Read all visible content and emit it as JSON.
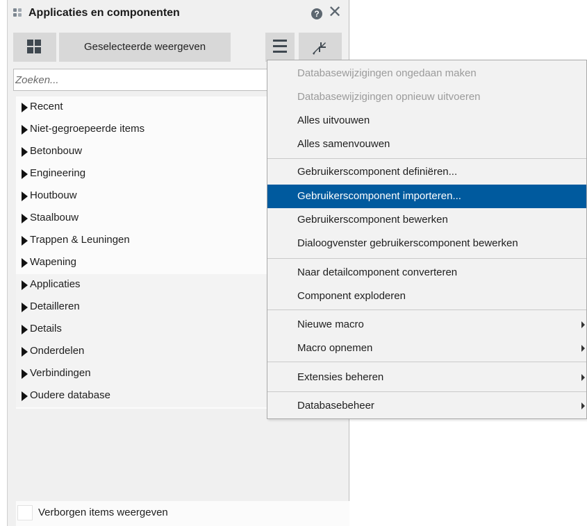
{
  "panel": {
    "title": "Applicaties en componenten",
    "help_icon": "?",
    "close_icon": "✕",
    "selected_button": "Geselecteerde weergeven",
    "search_placeholder": "Zoeken...",
    "footer_label": "Verborgen items weergeven"
  },
  "tree": [
    "Recent",
    "Niet-gegroepeerde items",
    "Betonbouw",
    "Engineering",
    "Houtbouw",
    "Staalbouw",
    "Trappen & Leuningen",
    "Wapening",
    "Applicaties",
    "Detailleren",
    "Details",
    "Onderdelen",
    "Verbindingen",
    "Oudere database"
  ],
  "menu": [
    {
      "label": "Databasewijzigingen ongedaan maken",
      "disabled": true
    },
    {
      "label": "Databasewijzigingen opnieuw uitvoeren",
      "disabled": true
    },
    {
      "label": "Alles uitvouwen"
    },
    {
      "label": "Alles samenvouwen"
    },
    {
      "label": "Gebruikerscomponent definiëren..."
    },
    {
      "label": "Gebruikerscomponent importeren...",
      "highlighted": true
    },
    {
      "label": "Gebruikerscomponent bewerken"
    },
    {
      "label": "Dialoogvenster gebruikerscomponent bewerken"
    },
    {
      "label": "Naar detailcomponent converteren"
    },
    {
      "label": "Component exploderen"
    },
    {
      "label": "Nieuwe macro",
      "submenu": true
    },
    {
      "label": "Macro opnemen",
      "submenu": true
    },
    {
      "label": "Extensies beheren",
      "submenu": true
    },
    {
      "label": "Databasebeheer",
      "submenu": true
    }
  ],
  "colors": {
    "highlight": "#005a9e",
    "panel_bg": "#f0f0f0",
    "button_bg": "#d8d8d8"
  }
}
